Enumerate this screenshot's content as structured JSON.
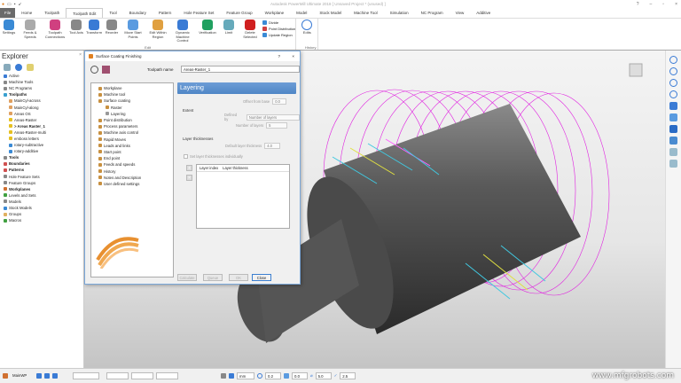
{
  "window": {
    "title": "Autodesk PowerMill Ultimate 2018  [ Unsaved Project * (unused) ]"
  },
  "tabs": [
    "File",
    "Home",
    "Toolpath",
    "Toolpath Edit",
    "Tool",
    "Boundary",
    "Pattern",
    "Hole Feature Set",
    "Feature Group",
    "Workplane",
    "Model",
    "Stock Model",
    "Machine Tool",
    "Simulation",
    "NC Program",
    "View",
    "Additive"
  ],
  "ribbon": {
    "edit_buttons": [
      "Settings",
      "Feeds & Speeds",
      "Toolpath Connections",
      "Tool Axis",
      "Transform",
      "Reorder",
      "Move Start Points",
      "Edit Within Region",
      "Dynamic Machine Control",
      "Verification",
      "Limit",
      "Delete Selected"
    ],
    "small_buttons": [
      "Divide",
      "Point Distribution",
      "Update Region"
    ],
    "edit_group": "Edit",
    "history_button": "Edits",
    "history_group": "History"
  },
  "explorer": {
    "title": "Explorer",
    "items": [
      {
        "label": "Active",
        "bold": false,
        "indent": 0,
        "color": "#3a7bd5"
      },
      {
        "label": "Machine Tools",
        "bold": false,
        "indent": 0,
        "color": "#888"
      },
      {
        "label": "NC Programs",
        "bold": false,
        "indent": 0,
        "color": "#888"
      },
      {
        "label": "Toolpaths",
        "bold": true,
        "indent": 0,
        "color": "#3aa0d0"
      },
      {
        "label": "MainCyl-across",
        "bold": false,
        "indent": 1,
        "color": "#e0a060"
      },
      {
        "label": "MainCyl-along",
        "bold": false,
        "indent": 1,
        "color": "#e0a060"
      },
      {
        "label": "Areas OS",
        "bold": false,
        "indent": 1,
        "color": "#e0a060"
      },
      {
        "label": "Areas-Raster",
        "bold": false,
        "indent": 1,
        "color": "#e6c020"
      },
      {
        "label": "> Areas Raster_1",
        "bold": true,
        "indent": 1,
        "color": "#e6c020"
      },
      {
        "label": "Areas-Raster-multi",
        "bold": false,
        "indent": 1,
        "color": "#e6c020"
      },
      {
        "label": "emboss letters",
        "bold": false,
        "indent": 1,
        "color": "#e6c020"
      },
      {
        "label": "rotary-subtractive",
        "bold": false,
        "indent": 1,
        "color": "#3a8ad5"
      },
      {
        "label": "rotary-additive",
        "bold": false,
        "indent": 1,
        "color": "#3a8ad5"
      },
      {
        "label": "Tools",
        "bold": true,
        "indent": 0,
        "color": "#888"
      },
      {
        "label": "Boundaries",
        "bold": true,
        "indent": 0,
        "color": "#d05050"
      },
      {
        "label": "Patterns",
        "bold": true,
        "indent": 0,
        "color": "#d05050"
      },
      {
        "label": "Hole Feature Sets",
        "bold": false,
        "indent": 0,
        "color": "#888"
      },
      {
        "label": "Feature Groups",
        "bold": false,
        "indent": 0,
        "color": "#888"
      },
      {
        "label": "Workplanes",
        "bold": true,
        "indent": 0,
        "color": "#d07030"
      },
      {
        "label": "Levels and Sets",
        "bold": false,
        "indent": 0,
        "color": "#40a040"
      },
      {
        "label": "Models",
        "bold": false,
        "indent": 0,
        "color": "#888"
      },
      {
        "label": "Stock Models",
        "bold": false,
        "indent": 0,
        "color": "#3a8ad5"
      },
      {
        "label": "Groups",
        "bold": false,
        "indent": 0,
        "color": "#e0b060"
      },
      {
        "label": "Macros",
        "bold": false,
        "indent": 0,
        "color": "#40a040"
      }
    ]
  },
  "dialog": {
    "title": "Surface Coating Finishing",
    "help": "?",
    "close": "×",
    "toolpath_name_label": "Toolpath name",
    "toolpath_name": "Areas-Raster_1",
    "tree": [
      {
        "label": "Workplane",
        "indent": 0
      },
      {
        "label": "Machine tool",
        "indent": 0
      },
      {
        "label": "Surface coating",
        "indent": 0
      },
      {
        "label": "Raster",
        "indent": 1
      },
      {
        "label": "Layering",
        "indent": 1
      },
      {
        "label": "Point distribution",
        "indent": 0
      },
      {
        "label": "Process parameters",
        "indent": 0
      },
      {
        "label": "Machine axis control",
        "indent": 0
      },
      {
        "label": "Rapid Moves",
        "indent": 0
      },
      {
        "label": "Leads and links",
        "indent": 0
      },
      {
        "label": "Start point",
        "indent": 0
      },
      {
        "label": "End point",
        "indent": 0
      },
      {
        "label": "Feeds and speeds",
        "indent": 0
      },
      {
        "label": "History",
        "indent": 0
      },
      {
        "label": "Notes and Description",
        "indent": 0
      },
      {
        "label": "User defined settings",
        "indent": 0
      }
    ],
    "panel_title": "Layering",
    "offset_label": "Offset from base",
    "offset_value": "0.0",
    "extent_label": "Extent",
    "defined_by_label": "Defined by",
    "defined_by_value": "Number of layers",
    "num_layers_label": "Number of layers",
    "num_layers_value": "5",
    "layer_thick_label": "Layer thicknesses",
    "default_thick_label": "Default layer thickness",
    "default_thick_value": "4.0",
    "individually_label": "Set layer thicknesses individually",
    "col_index": "Layer index",
    "col_thickness": "Layer thickness",
    "buttons": [
      "Calculate",
      "Queue",
      "OK",
      "Close"
    ]
  },
  "status": {
    "workplane": "MainWP",
    "units": "mm",
    "tolerance": "0.2",
    "thickness": "0.0",
    "diameter": "5.0",
    "step": "2.5"
  },
  "watermark": "www.mfgrobots.com"
}
